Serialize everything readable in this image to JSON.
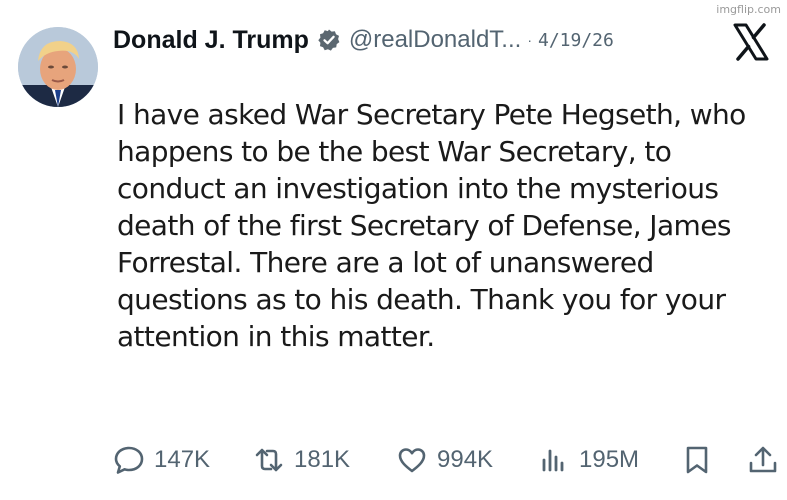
{
  "watermark": "imgflip.com",
  "post": {
    "author_name": "Donald J. Trump",
    "handle": "@realDonaldT...",
    "separator": "·",
    "date": "4/19/26",
    "text_lines": [
      "I have asked War Secretary Pete Hegseth, who",
      "happens to be the best War Secretary, to",
      "conduct an investigation into the mysterious",
      "death of the first Secretary of Defense, James",
      "Forrestal.  There are a lot of unanswered",
      "questions as to his death.  Thank you for your",
      "attention in this matter."
    ]
  },
  "actions": {
    "replies": "147K",
    "reposts": "181K",
    "likes": "994K",
    "views": "195M"
  },
  "colors": {
    "text": "#0f1419",
    "secondary": "#536471",
    "verified_badge": "#5b6770"
  },
  "icons": {
    "verified": "verified-badge-icon",
    "platform": "x-logo-icon",
    "reply": "reply-icon",
    "repost": "repost-icon",
    "like": "heart-icon",
    "views": "views-icon",
    "bookmark": "bookmark-icon",
    "share": "share-icon"
  }
}
